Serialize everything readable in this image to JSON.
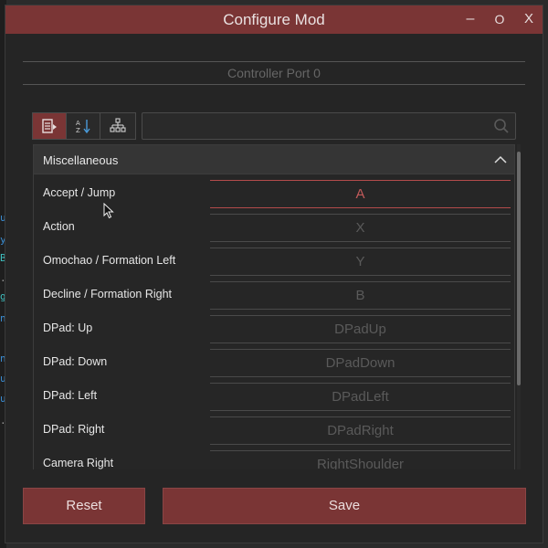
{
  "desktop": {
    "glyphs": [
      "u",
      "y",
      "B",
      ".",
      "g",
      "n",
      "n",
      "u",
      "u",
      "."
    ]
  },
  "window": {
    "title": "Configure Mod",
    "controls": {
      "minimize": "–",
      "maximize": "O",
      "close": "X"
    }
  },
  "port": {
    "label": "Controller Port 0"
  },
  "search": {
    "value": "",
    "placeholder": ""
  },
  "section": {
    "title": "Miscellaneous",
    "rows": [
      {
        "label": "Accept / Jump",
        "value": "A"
      },
      {
        "label": "Action",
        "value": "X"
      },
      {
        "label": "Omochao / Formation Left",
        "value": "Y"
      },
      {
        "label": "Decline / Formation Right",
        "value": "B"
      },
      {
        "label": "DPad: Up",
        "value": "DPadUp"
      },
      {
        "label": "DPad: Down",
        "value": "DPadDown"
      },
      {
        "label": "DPad: Left",
        "value": "DPadLeft"
      },
      {
        "label": "DPad: Right",
        "value": "DPadRight"
      },
      {
        "label": "Camera Right",
        "value": "RightShoulder"
      }
    ]
  },
  "buttons": {
    "reset": "Reset",
    "save": "Save"
  },
  "colors": {
    "accent": "#7a3535",
    "active_border": "#b34b4b",
    "background": "#252525"
  }
}
